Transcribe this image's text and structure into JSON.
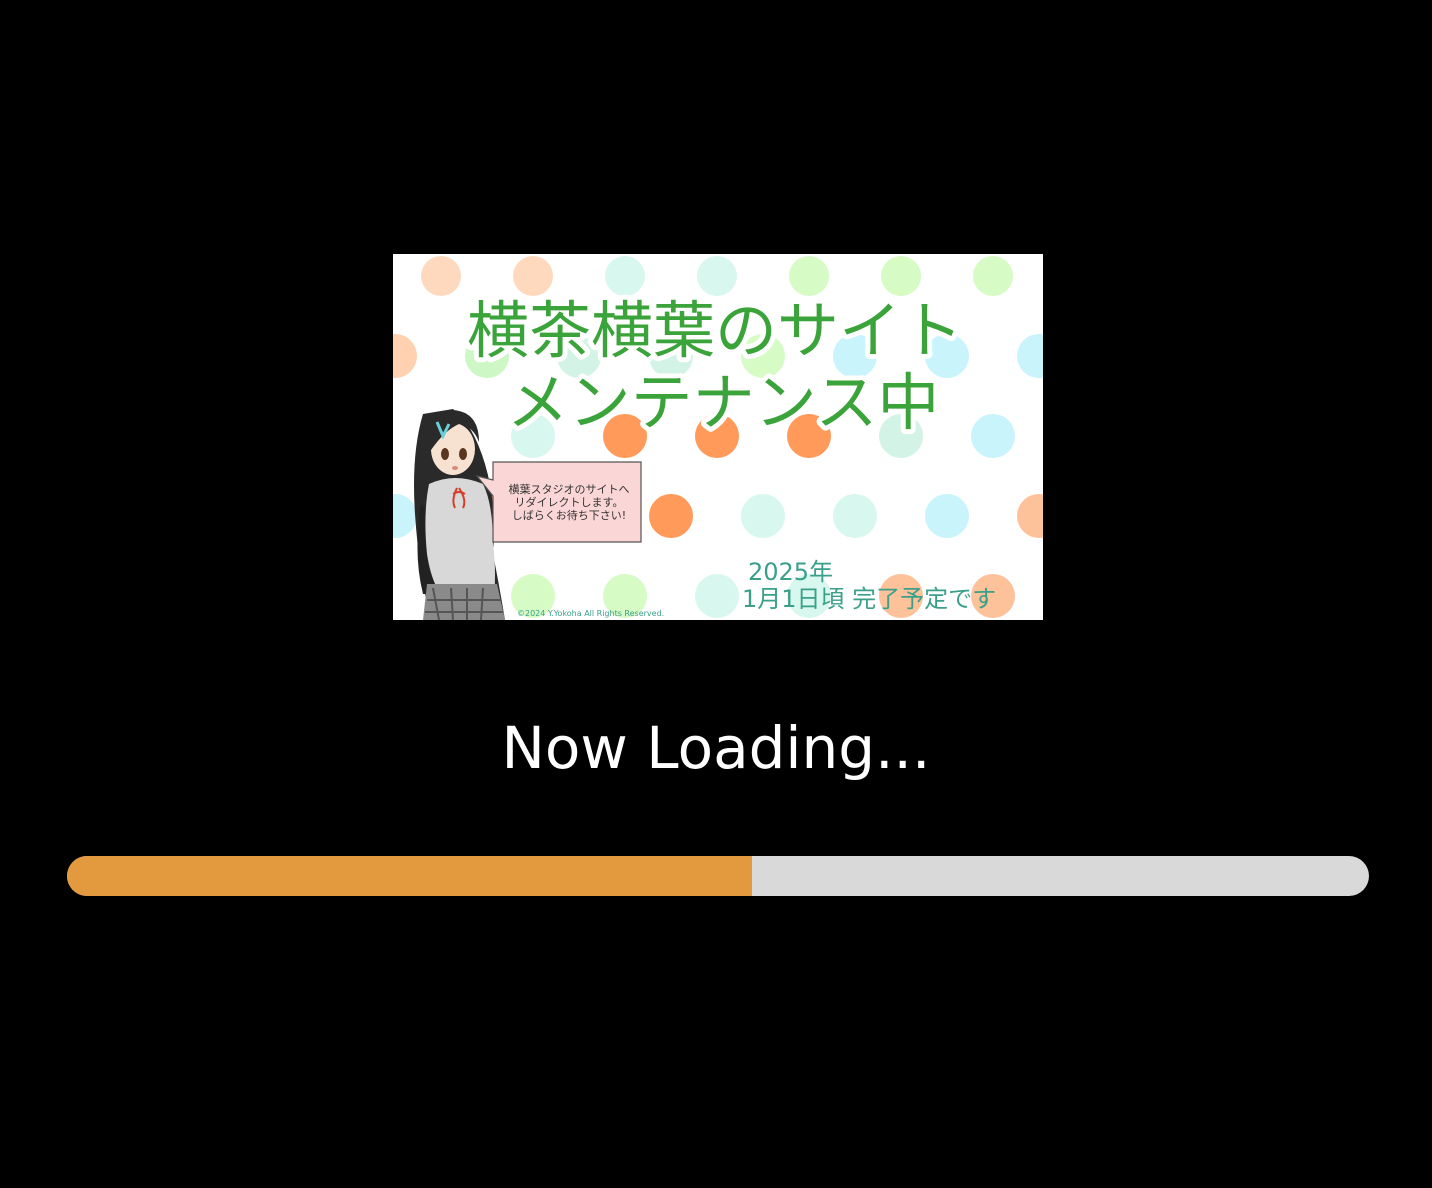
{
  "banner": {
    "title_line1": "横茶横葉のサイト",
    "title_line2": "メンテナンス中",
    "bubble_line1": "横葉スタジオのサイトへ",
    "bubble_line2": "リダイレクトします。",
    "bubble_line3": "しばらくお待ち下さい!",
    "date_line1": "2025年",
    "date_line2": "1月1日頃 完了予定です",
    "copyright": "©2024 Y.Yokoha All Rights Reserved."
  },
  "loading": {
    "label": "Now Loading...",
    "progress_fraction": 0.526
  },
  "colors": {
    "background": "#000000",
    "progress_fill": "#e3993e",
    "progress_track": "#d9d9d9",
    "title_green": "#3aa33a",
    "date_teal": "#3aa08a"
  }
}
